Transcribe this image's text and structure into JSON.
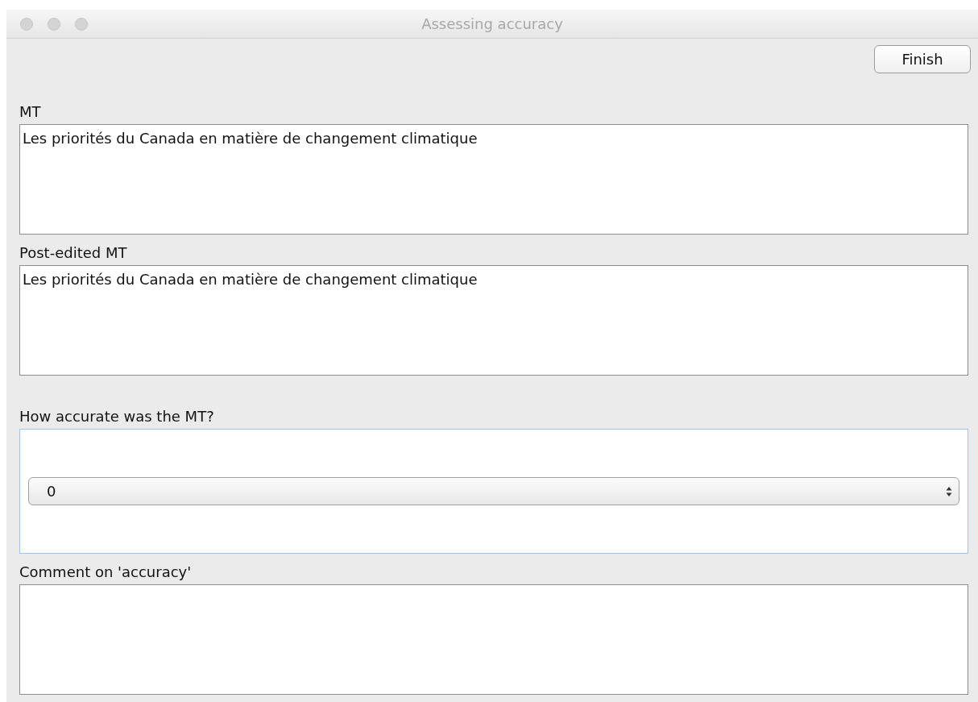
{
  "window": {
    "title": "Assessing accuracy"
  },
  "toolbar": {
    "finish_button": "Finish"
  },
  "fields": [
    {
      "kind": "textarea",
      "label": "MT",
      "value": "Les priorités du Canada en matière de changement climatique"
    },
    {
      "kind": "textarea",
      "label": "Post-edited MT",
      "value": "Les priorités du Canada en matière de changement climatique"
    },
    {
      "kind": "select",
      "label": "How accurate was the MT?",
      "value": "0"
    },
    {
      "kind": "textarea",
      "label": "Comment on 'accuracy'"
    }
  ]
}
